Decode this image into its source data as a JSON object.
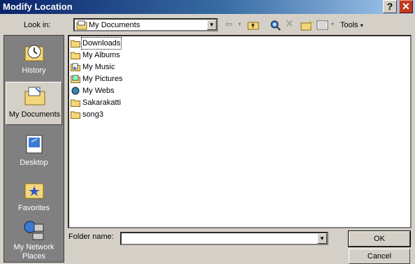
{
  "window": {
    "title": "Modify Location"
  },
  "toolbar": {
    "look_in_label": "Look in:",
    "look_in_value": "My Documents",
    "tools_label": "Tools"
  },
  "places": [
    {
      "label": "History",
      "icon": "history-icon"
    },
    {
      "label": "My Documents",
      "icon": "my-documents-icon",
      "selected": true
    },
    {
      "label": "Desktop",
      "icon": "desktop-icon"
    },
    {
      "label": "Favorites",
      "icon": "favorites-icon"
    },
    {
      "label": "My Network Places",
      "icon": "network-places-icon"
    }
  ],
  "files": [
    {
      "name": "Downloads",
      "icon": "folder-icon"
    },
    {
      "name": "My Albums",
      "icon": "folder-icon"
    },
    {
      "name": "My Music",
      "icon": "music-folder-icon"
    },
    {
      "name": "My Pictures",
      "icon": "pictures-folder-icon"
    },
    {
      "name": "My Webs",
      "icon": "web-folder-icon"
    },
    {
      "name": "Sakarakatti",
      "icon": "folder-icon"
    },
    {
      "name": "song3",
      "icon": "folder-icon"
    }
  ],
  "footer": {
    "folder_name_label": "Folder name:",
    "folder_name_value": "",
    "ok_label": "OK",
    "cancel_label": "Cancel"
  }
}
